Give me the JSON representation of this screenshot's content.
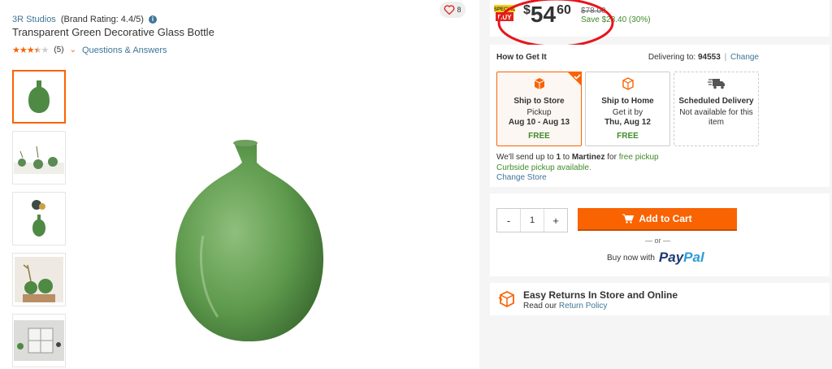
{
  "product": {
    "brand": "3R Studios",
    "brand_rating": "(Brand Rating: 4.4/5)",
    "title": "Transparent Green Decorative Glass Bottle",
    "rating_count": "(5)",
    "qa_label": "Questions & Answers",
    "favorites_count": "8",
    "rating_value": 3.5
  },
  "thumbnails": [
    {
      "name": "thumb-bottle"
    },
    {
      "name": "thumb-lifestyle-group"
    },
    {
      "name": "thumb-bottle-flowers"
    },
    {
      "name": "thumb-bottles-branch"
    },
    {
      "name": "thumb-shelf"
    }
  ],
  "price": {
    "badge": "SPECIAL BUY",
    "dollar_sign": "$",
    "whole": "54",
    "cents": "60",
    "was": "$78.00",
    "save": "Save $23.40 (30%)"
  },
  "fulfillment": {
    "title": "How to Get It",
    "delivering_to_label": "Delivering to:",
    "zip": "94553",
    "separator": "|",
    "change_label": "Change",
    "options": [
      {
        "name": "Ship to Store",
        "line1": "Pickup",
        "line2": "Aug 10 - Aug 13",
        "price": "FREE"
      },
      {
        "name": "Ship to Home",
        "line1": "Get it by",
        "line2": "Thu, Aug 12",
        "price": "FREE"
      },
      {
        "name": "Scheduled Delivery",
        "line1": "Not available for this item",
        "line2": "",
        "price": ""
      }
    ],
    "send_text_1": "We'll send up to",
    "send_qty": "1",
    "send_text_2": "to",
    "send_store": "Martinez",
    "send_text_3": "for",
    "send_free": "free pickup",
    "curbside": "Curbside pickup available.",
    "change_store": "Change Store"
  },
  "cart": {
    "minus": "-",
    "qty": "1",
    "plus": "+",
    "add_to_cart": "Add to Cart",
    "or": "— or —",
    "buy_now_with": "Buy now with",
    "paypal_pay": "Pay",
    "paypal_pal": "Pal"
  },
  "returns": {
    "title": "Easy Returns In Store and Online",
    "read_our": "Read our",
    "policy_link": "Return Policy"
  },
  "colors": {
    "accent": "#f96302",
    "link": "#3e7697",
    "green": "#3f8b2a",
    "annotation": "#e8141c"
  }
}
